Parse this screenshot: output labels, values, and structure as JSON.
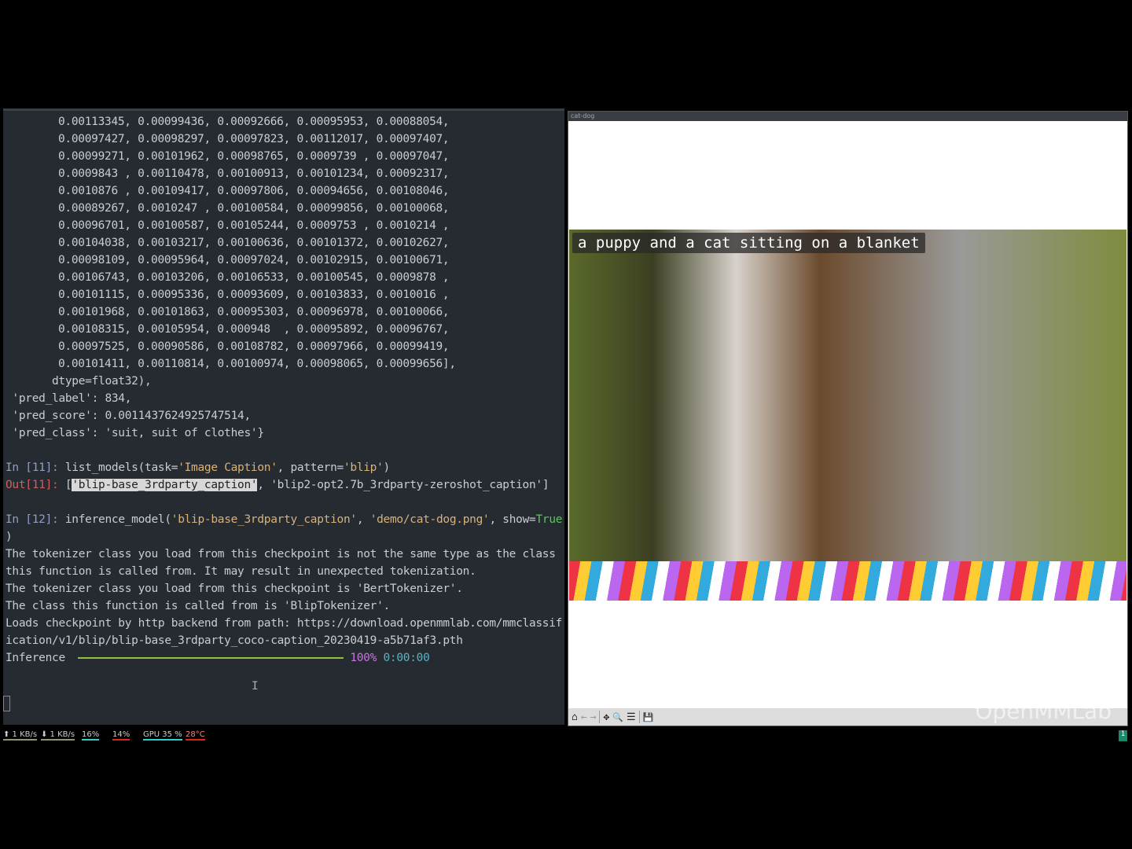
{
  "terminal": {
    "array_rows": [
      "0.00113345, 0.00099436, 0.00092666, 0.00095953, 0.00088054,",
      "0.00097427, 0.00098297, 0.00097823, 0.00112017, 0.00097407,",
      "0.00099271, 0.00101962, 0.00098765, 0.0009739 , 0.00097047,",
      "0.0009843 , 0.00110478, 0.00100913, 0.00101234, 0.00092317,",
      "0.0010876 , 0.00109417, 0.00097806, 0.00094656, 0.00108046,",
      "0.00089267, 0.0010247 , 0.00100584, 0.00099856, 0.00100068,",
      "0.00096701, 0.00100587, 0.00105244, 0.0009753 , 0.0010214 ,",
      "0.00104038, 0.00103217, 0.00100636, 0.00101372, 0.00102627,",
      "0.00098109, 0.00095964, 0.00097024, 0.00102915, 0.00100671,",
      "0.00106743, 0.00103206, 0.00106533, 0.00100545, 0.0009878 ,",
      "0.00101115, 0.00095336, 0.00093609, 0.00103833, 0.0010016 ,",
      "0.00101968, 0.00101863, 0.00095303, 0.00096978, 0.00100066,",
      "0.00108315, 0.00105954, 0.000948  , 0.00095892, 0.00096767,",
      "0.00097525, 0.00090586, 0.00108782, 0.00097966, 0.00099419,",
      "0.00101411, 0.00110814, 0.00100974, 0.00098065, 0.00099656],"
    ],
    "dtype": "dtype=float32),",
    "pred_label": " 'pred_label': 834,",
    "pred_score": " 'pred_score': 0.0011437624925747514,",
    "pred_class": " 'pred_class': 'suit, suit of clothes'}",
    "in11_prompt": "In [11]: ",
    "in11_code1": "list_models(task=",
    "in11_str1": "'Image Caption'",
    "in11_code2": ", pattern=",
    "in11_str2": "'blip'",
    "in11_code3": ")",
    "out11_prompt": "Out[11]: ",
    "out11_open": "[",
    "out11_sel": "'blip-base_3rdparty_caption'",
    "out11_rest": ", 'blip2-opt2.7b_3rdparty-zeroshot_caption']",
    "in12_prompt": "In [12]: ",
    "in12_code1": "inference_model(",
    "in12_str1": "'blip-base_3rdparty_caption'",
    "in12_code2": ", ",
    "in12_str2": "'demo/cat-dog.png'",
    "in12_code3": ", show=",
    "in12_kw": "True",
    "in12_close": ")",
    "log": [
      "The tokenizer class you load from this checkpoint is not the same type as the class",
      "this function is called from. It may result in unexpected tokenization.",
      "The tokenizer class you load from this checkpoint is 'BertTokenizer'.",
      "The class this function is called from is 'BlipTokenizer'.",
      "Loads checkpoint by http backend from path: https://download.openmmlab.com/mmclassif",
      "ication/v1/blip/blip-base_3rdparty_coco-caption_20230419-a5b71af3.pth"
    ],
    "progress_label": "Inference ",
    "progress_percent": "100%",
    "progress_time": "0:00:00",
    "progress_value": 1.0,
    "text_cursor": "I"
  },
  "figure": {
    "title": "cat-dog",
    "caption": "a puppy and a cat sitting on a blanket",
    "watermark": "OpenMMLab"
  },
  "toolbar": {
    "home": "⌂",
    "back": "←",
    "forward": "→",
    "pan": "✥",
    "zoom": "🔍",
    "configure": "☰",
    "save": "💾"
  },
  "status": {
    "net_up": "⬆ 1 KB/s",
    "net_down": "⬇ 1 KB/s",
    "mem": "16%",
    "cpu": "14%",
    "gpu": "GPU 35 %",
    "temp": "28°C",
    "workspace": "1"
  }
}
